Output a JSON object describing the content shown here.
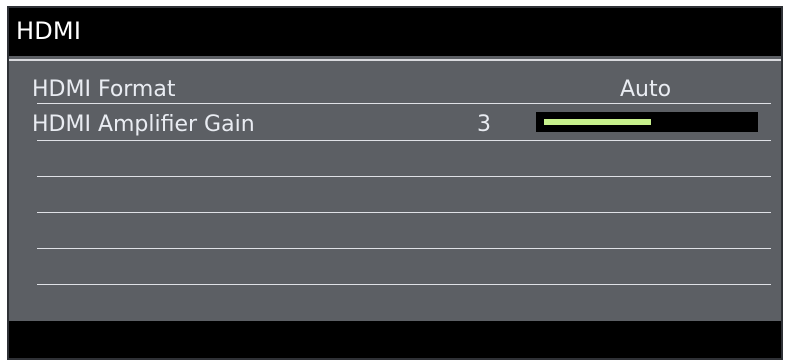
{
  "title": "HDMI",
  "menu": {
    "items": [
      {
        "label": "HDMI Format",
        "value": "Auto"
      },
      {
        "label": "HDMI Amplifier Gain",
        "value": "3",
        "level": 0.52
      }
    ]
  },
  "colors": {
    "panel": "#5c5f64",
    "title_bar": "#000000",
    "text": "#e9ecf2",
    "gain_fill": "#c7f08c",
    "lines": "#dfe1e6"
  }
}
